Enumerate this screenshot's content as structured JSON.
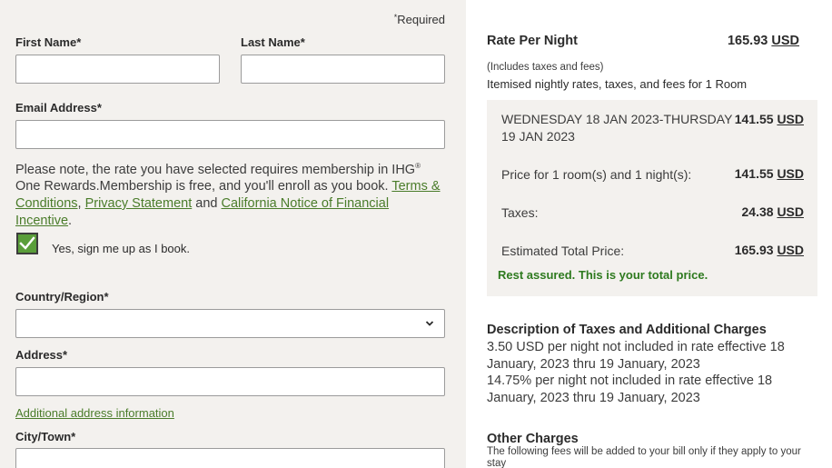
{
  "form": {
    "required_note": "Required",
    "first_name_label": "First Name",
    "last_name_label": "Last Name",
    "email_label": "Email Address",
    "membership_note": {
      "part1": "Please note, the rate you have selected requires membership in IHG",
      "reg": "®",
      "part2": " One Rewards.Membership is free, and you'll enroll as you book. ",
      "terms_link": "Terms & Conditions",
      "comma": ", ",
      "privacy_link": "Privacy Statement",
      "and": " and ",
      "california_link": "California Notice of Financial Incentive",
      "period": "."
    },
    "signup_label": "Yes, sign me up as I book.",
    "signup_checked": true,
    "country_label": "Country/Region",
    "country_value": "",
    "address_label": "Address",
    "additional_address_link": "Additional address information",
    "city_label": "City/Town",
    "asterisk": "*"
  },
  "summary": {
    "rate_title": "Rate Per Night",
    "rate_amount": "165.93",
    "currency": "USD",
    "includes_note": "(Includes taxes and fees)",
    "itemised_title": "Itemised nightly rates, taxes, and fees for 1 Room",
    "dates_line1": "WEDNESDAY 18 JAN 2023-THURSDAY",
    "dates_line2": "19 JAN 2023",
    "dates_amount": "141.55",
    "price_label": "Price for 1 room(s) and 1 night(s):",
    "price_amount": "141.55",
    "taxes_label": "Taxes:",
    "taxes_amount": "24.38",
    "total_label": "Estimated Total Price:",
    "total_amount": "165.93",
    "assured": "Rest assured. This is your total price.",
    "taxes_desc_title": "Description of Taxes and Additional Charges",
    "tax_line1": "3.50 USD per night not included in rate effective 18 January, 2023 thru 19 January, 2023",
    "tax_line2": "14.75% per night not included in rate effective 18 January, 2023 thru 19 January, 2023",
    "other_charges_title": "Other Charges",
    "other_charges_text": "The following fees will be added to your bill only if they apply to your stay"
  },
  "colors": {
    "accent_green": "#4a7c2a",
    "checkbox_green": "#5a9e3a",
    "assured_green": "#2e7a1f",
    "panel_bg": "#f3f1ee"
  }
}
